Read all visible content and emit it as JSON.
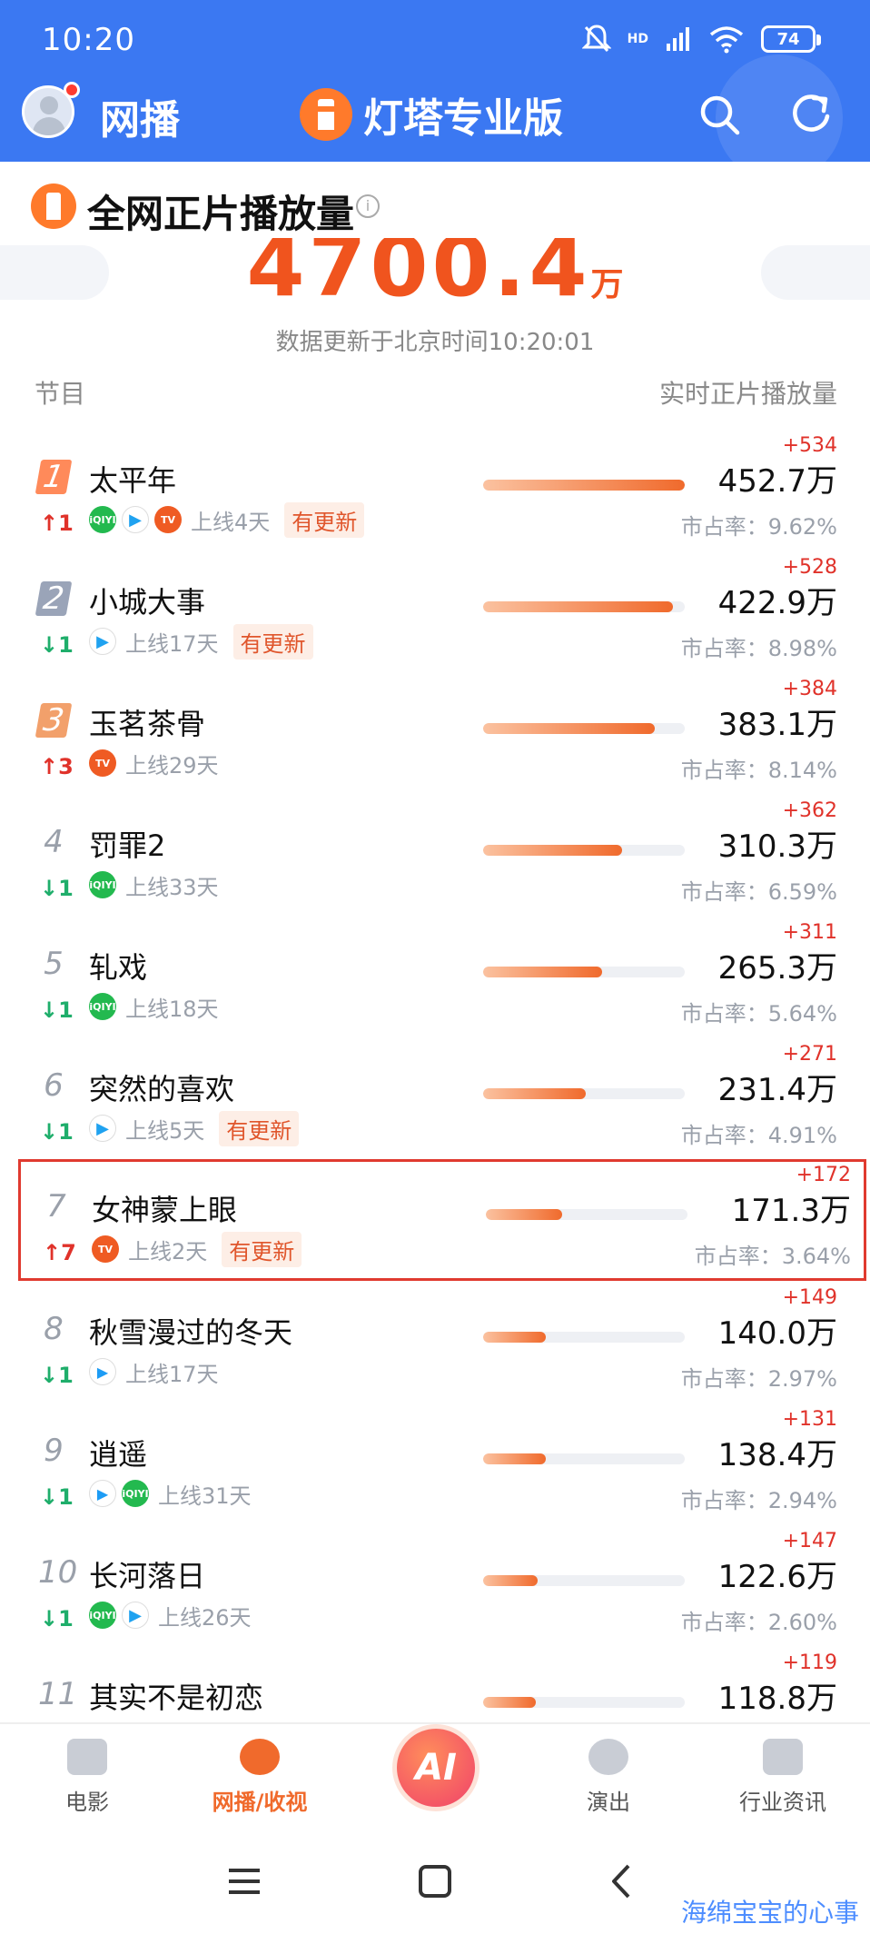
{
  "status": {
    "time": "10:20",
    "network": "HD",
    "battery": "74"
  },
  "app": {
    "tab": "网播",
    "brand": "灯塔专业版"
  },
  "section": {
    "title": "全网正片播放量",
    "info": "i"
  },
  "total": {
    "value": "4700.4",
    "unit": "万",
    "update_text": "数据更新于北京时间10:20:01"
  },
  "columns": {
    "left": "节目",
    "right": "实时正片播放量"
  },
  "rows": [
    {
      "rank": "1",
      "title": "太平年",
      "change_dir": "up",
      "change_text": "↑1",
      "platforms": [
        "iqiyi",
        "tencent",
        "mango"
      ],
      "online": "上线4天",
      "tag": "有更新",
      "bar": 1.0,
      "inc": "+534",
      "value": "452.7万",
      "share": "市占率：9.62%"
    },
    {
      "rank": "2",
      "title": "小城大事",
      "change_dir": "down",
      "change_text": "↓1",
      "platforms": [
        "tencent"
      ],
      "online": "上线17天",
      "tag": "有更新",
      "bar": 0.94,
      "inc": "+528",
      "value": "422.9万",
      "share": "市占率：8.98%"
    },
    {
      "rank": "3",
      "title": "玉茗茶骨",
      "change_dir": "up",
      "change_text": "↑3",
      "platforms": [
        "mango"
      ],
      "online": "上线29天",
      "tag": "",
      "bar": 0.85,
      "inc": "+384",
      "value": "383.1万",
      "share": "市占率：8.14%"
    },
    {
      "rank": "4",
      "title": "罚罪2",
      "change_dir": "down",
      "change_text": "↓1",
      "platforms": [
        "iqiyi"
      ],
      "online": "上线33天",
      "tag": "",
      "bar": 0.69,
      "inc": "+362",
      "value": "310.3万",
      "share": "市占率：6.59%"
    },
    {
      "rank": "5",
      "title": "轧戏",
      "change_dir": "down",
      "change_text": "↓1",
      "platforms": [
        "iqiyi"
      ],
      "online": "上线18天",
      "tag": "",
      "bar": 0.59,
      "inc": "+311",
      "value": "265.3万",
      "share": "市占率：5.64%"
    },
    {
      "rank": "6",
      "title": "突然的喜欢",
      "change_dir": "down",
      "change_text": "↓1",
      "platforms": [
        "tencent"
      ],
      "online": "上线5天",
      "tag": "有更新",
      "bar": 0.51,
      "inc": "+271",
      "value": "231.4万",
      "share": "市占率：4.91%"
    },
    {
      "rank": "7",
      "title": "女神蒙上眼",
      "change_dir": "up",
      "change_text": "↑7",
      "platforms": [
        "mango"
      ],
      "online": "上线2天",
      "tag": "有更新",
      "bar": 0.38,
      "inc": "+172",
      "value": "171.3万",
      "share": "市占率：3.64%",
      "highlight": true
    },
    {
      "rank": "8",
      "title": "秋雪漫过的冬天",
      "change_dir": "down",
      "change_text": "↓1",
      "platforms": [
        "youku"
      ],
      "online": "上线17天",
      "tag": "",
      "bar": 0.31,
      "inc": "+149",
      "value": "140.0万",
      "share": "市占率：2.97%"
    },
    {
      "rank": "9",
      "title": "逍遥",
      "change_dir": "down",
      "change_text": "↓1",
      "platforms": [
        "youku",
        "iqiyi"
      ],
      "online": "上线31天",
      "tag": "",
      "bar": 0.31,
      "inc": "+131",
      "value": "138.4万",
      "share": "市占率：2.94%"
    },
    {
      "rank": "10",
      "title": "长河落日",
      "change_dir": "down",
      "change_text": "↓1",
      "platforms": [
        "iqiyi",
        "tencent"
      ],
      "online": "上线26天",
      "tag": "",
      "bar": 0.27,
      "inc": "+147",
      "value": "122.6万",
      "share": "市占率：2.60%"
    },
    {
      "rank": "11",
      "title": "其实不是初恋",
      "change_dir": "",
      "change_text": "",
      "platforms": [],
      "online": "",
      "tag": "",
      "bar": 0.26,
      "inc": "+119",
      "value": "118.8万",
      "share": ""
    }
  ],
  "nav": {
    "movie": "电影",
    "stream": "网播/收视",
    "ai": "AI",
    "show": "演出",
    "news": "行业资讯"
  },
  "watermark": "海绵宝宝的心事",
  "colors": {
    "header_blue": "#3b78f2",
    "accent_orange": "#f06a2c",
    "rise_red": "#e0322a",
    "fall_green": "#1fae6b"
  }
}
